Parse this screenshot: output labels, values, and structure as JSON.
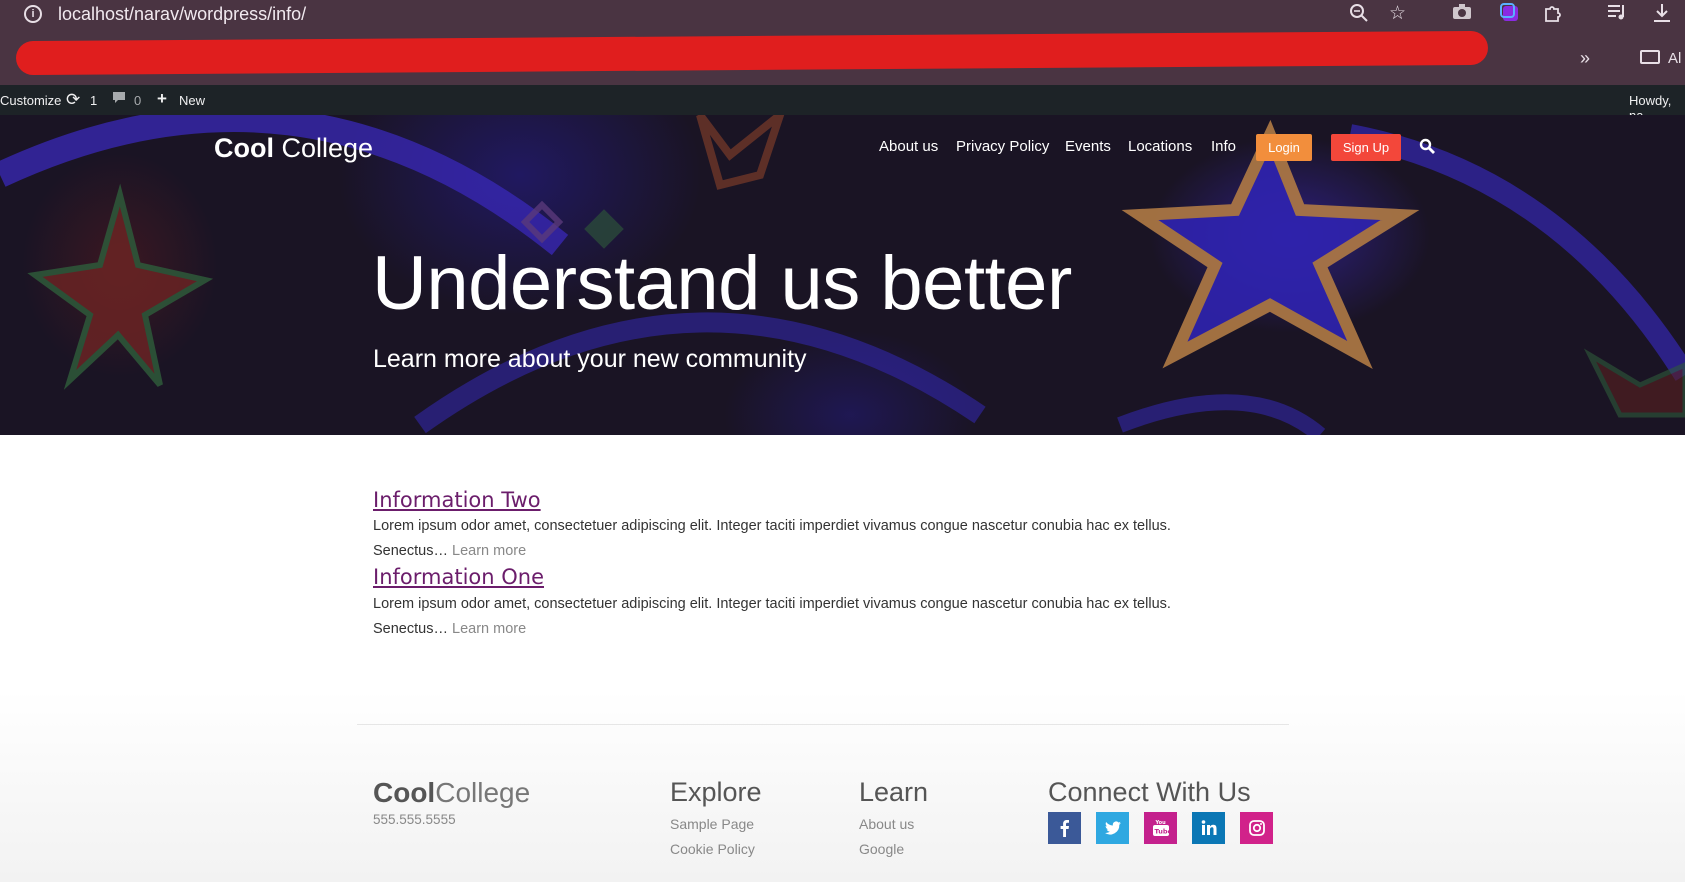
{
  "browser": {
    "url": "localhost/narav/wordpress/info/",
    "bookmarks_overflow": "»",
    "all_bookmarks_partial": "Al"
  },
  "adminbar": {
    "customize": "Customize",
    "revisions_count": "1",
    "comments_count": "0",
    "new_label": "New",
    "howdy": "Howdy, na"
  },
  "site": {
    "logo_bold": "Cool",
    "logo_thin": "College"
  },
  "nav": {
    "items": [
      "About us",
      "Privacy Policy",
      "Events",
      "Locations",
      "Info"
    ],
    "login": "Login",
    "signup": "Sign Up"
  },
  "hero": {
    "title": "Understand us better",
    "subtitle": "Learn more about your new community"
  },
  "posts": [
    {
      "title": "Information Two",
      "excerpt_line1": "Lorem ipsum odor amet, consectetuer adipiscing elit. Integer taciti imperdiet vivamus congue nascetur conubia hac ex tellus.",
      "excerpt_line2": "Senectus…",
      "more": "Learn more"
    },
    {
      "title": "Information One",
      "excerpt_line1": "Lorem ipsum odor amet, consectetuer adipiscing elit. Integer taciti imperdiet vivamus congue nascetur conubia hac ex tellus.",
      "excerpt_line2": "Senectus…",
      "more": "Learn more"
    }
  ],
  "footer": {
    "logo_bold": "Cool",
    "logo_thin": "College",
    "phone": "555.555.5555",
    "explore": {
      "heading": "Explore",
      "links": [
        "Sample Page",
        "Cookie Policy"
      ]
    },
    "learn": {
      "heading": "Learn",
      "links": [
        "About us",
        "Google"
      ]
    },
    "connect": {
      "heading": "Connect With Us",
      "social": [
        {
          "icon": "facebook-icon",
          "color": "#3b5998"
        },
        {
          "icon": "twitter-icon",
          "color": "#2fa8e1"
        },
        {
          "icon": "youtube-icon",
          "color": "#c4218d"
        },
        {
          "icon": "linkedin-icon",
          "color": "#0b77b5"
        },
        {
          "icon": "instagram-icon",
          "color": "#d1228a"
        }
      ]
    }
  },
  "colors": {
    "login_button": "#f28e3c",
    "signup_button": "#f3473a",
    "post_title": "#6b1d6b",
    "adminbar": "#1d2327",
    "browser_chrome": "#4a3442"
  }
}
